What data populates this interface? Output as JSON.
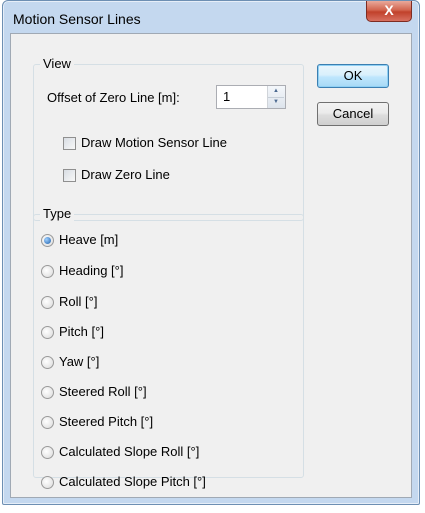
{
  "window": {
    "title": "Motion Sensor Lines",
    "close_symbol": "X"
  },
  "view_group": {
    "label": "View",
    "offset_label": "Offset of Zero Line [m]:",
    "offset_value": "1",
    "draw_motion_sensor_line": {
      "label": "Draw Motion Sensor Line",
      "checked": false
    },
    "draw_zero_line": {
      "label": "Draw Zero Line",
      "checked": false
    }
  },
  "type_group": {
    "label": "Type",
    "selected": "Heave [m]",
    "options": [
      "Heave [m]",
      "Heading [°]",
      "Roll [°]",
      "Pitch [°]",
      "Yaw [°]",
      "Steered Roll [°]",
      "Steered Pitch [°]",
      "Calculated Slope Roll [°]",
      "Calculated Slope Pitch [°]"
    ]
  },
  "buttons": {
    "ok": "OK",
    "cancel": "Cancel"
  },
  "icons": {
    "spin_up": "chevron-up-icon",
    "spin_down": "chevron-down-icon",
    "close": "close-icon"
  }
}
